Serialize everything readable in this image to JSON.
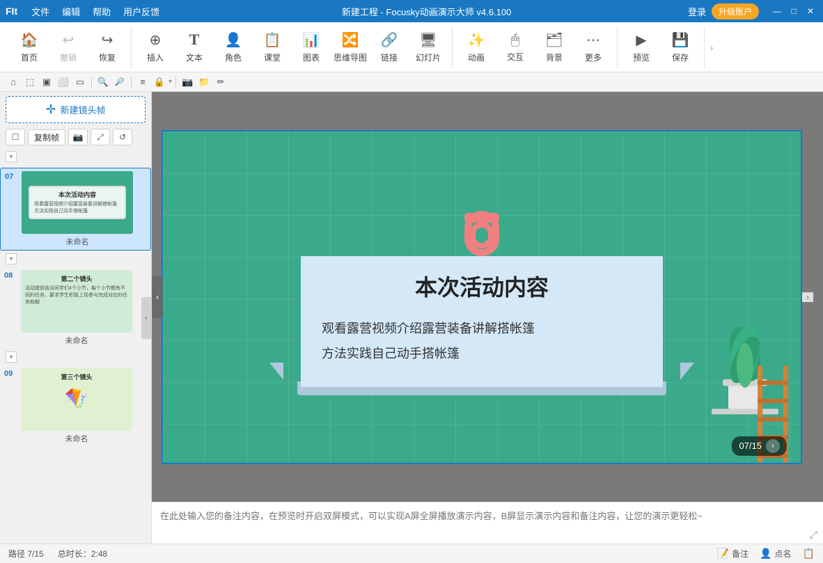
{
  "titlebar": {
    "logo": "FIt",
    "menu": [
      "文件",
      "编辑",
      "帮助",
      "用户反馈"
    ],
    "title": "新建工程 - Focusky动画演示大师 v4.6.100",
    "login_label": "登录",
    "upgrade_label": "升级账户",
    "win_minimize": "—",
    "win_maximize": "□",
    "win_close": "✕"
  },
  "toolbar": {
    "groups": [
      {
        "items": [
          {
            "id": "home",
            "icon": "🏠",
            "label": "首页"
          },
          {
            "id": "undo",
            "icon": "↩",
            "label": "撤销"
          },
          {
            "id": "redo",
            "icon": "↪",
            "label": "恢复"
          }
        ]
      },
      {
        "items": [
          {
            "id": "insert",
            "icon": "⊕",
            "label": "插入"
          },
          {
            "id": "text",
            "icon": "T",
            "label": "文本"
          },
          {
            "id": "role",
            "icon": "👤",
            "label": "角色"
          },
          {
            "id": "class",
            "icon": "📋",
            "label": "课堂"
          },
          {
            "id": "chart",
            "icon": "📊",
            "label": "图表"
          },
          {
            "id": "mindmap",
            "icon": "🔀",
            "label": "思维导图"
          },
          {
            "id": "link",
            "icon": "🔗",
            "label": "链接"
          },
          {
            "id": "slide",
            "icon": "🖥",
            "label": "幻灯片"
          }
        ]
      },
      {
        "items": [
          {
            "id": "animation",
            "icon": "✨",
            "label": "动画"
          },
          {
            "id": "interact",
            "icon": "🖱",
            "label": "交互"
          },
          {
            "id": "background",
            "icon": "🗂",
            "label": "背景"
          },
          {
            "id": "more",
            "icon": "⋯",
            "label": "更多"
          }
        ]
      },
      {
        "items": [
          {
            "id": "preview",
            "icon": "▶",
            "label": "预览"
          },
          {
            "id": "save",
            "icon": "💾",
            "label": "保存"
          }
        ]
      }
    ]
  },
  "icon_toolbar": {
    "icons": [
      "⌂",
      "⬜",
      "⬜",
      "⬜",
      "⬜",
      "|",
      "🔍+",
      "🔍-",
      "|",
      "≡",
      "🔒",
      "|",
      "📷",
      "📁",
      "✏"
    ]
  },
  "left_panel": {
    "new_frame_label": "新建镜头帧",
    "copy_btn": "复制帧",
    "slides": [
      {
        "number": "07",
        "label": "未命名",
        "active": true,
        "title": "本次活动内容",
        "content": "观看露营视频介绍露营装备讲解搭帐篷方法实践自己动手搭帐篷"
      },
      {
        "number": "08",
        "label": "未命名",
        "active": false,
        "title": "第二个镜头",
        "content": "活动提前告诉同学们4个小节，每个小节都有不同的任务，要求学生积极上场参与完成对应的任务和解"
      },
      {
        "number": "09",
        "label": "未命名",
        "active": false,
        "title": "第三个镜头",
        "content": ""
      }
    ]
  },
  "canvas": {
    "slide_title": "本次活动内容",
    "slide_line1": "观看露营视频介绍露营装备讲解搭帐篷",
    "slide_line2": "方法实践自己动手搭帐篷",
    "nav_text": "07/15",
    "nav_next": "›"
  },
  "notes": {
    "placeholder": "在此处输入您的备注内容，在预览时开启双屏模式，可以实现A屏全屏播放演示内容，B屏显示演示内容和备注内容，让您的演示更轻松~"
  },
  "status_bar": {
    "path": "路径 7/15",
    "total": "总时长：2:48",
    "notes_label": "备注",
    "dot_label": "点名",
    "extra_label": ""
  }
}
